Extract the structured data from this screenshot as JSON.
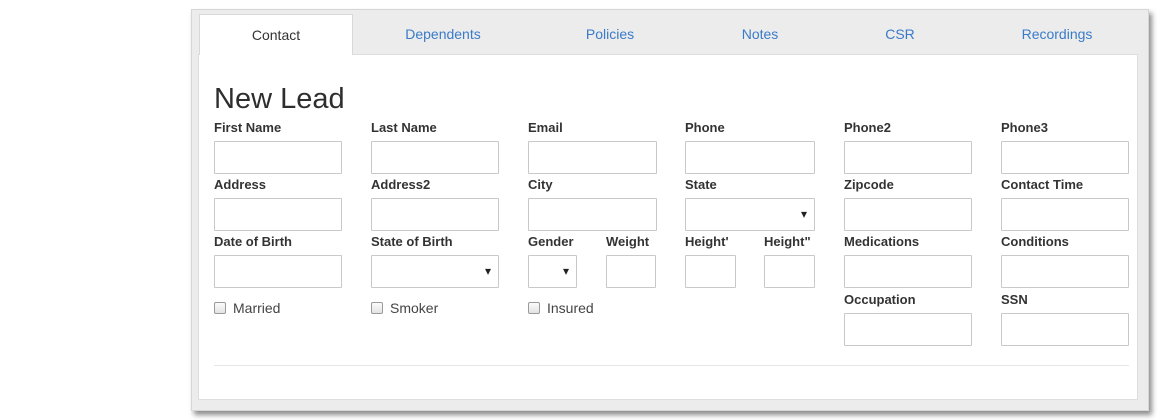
{
  "tabs": [
    {
      "label": "Contact",
      "active": true
    },
    {
      "label": "Dependents"
    },
    {
      "label": "Policies"
    },
    {
      "label": "Notes"
    },
    {
      "label": "CSR"
    },
    {
      "label": "Recordings"
    }
  ],
  "form": {
    "title": "New Lead",
    "labels": {
      "first_name": "First Name",
      "last_name": "Last Name",
      "email": "Email",
      "phone": "Phone",
      "phone2": "Phone2",
      "phone3": "Phone3",
      "address": "Address",
      "address2": "Address2",
      "city": "City",
      "state": "State",
      "zipcode": "Zipcode",
      "contact_time": "Contact Time",
      "date_of_birth": "Date of Birth",
      "state_of_birth": "State of Birth",
      "gender": "Gender",
      "weight": "Weight",
      "height_ft": "Height'",
      "height_in": "Height\"",
      "medications": "Medications",
      "conditions": "Conditions",
      "occupation": "Occupation",
      "ssn": "SSN"
    },
    "checkboxes": {
      "married": "Married",
      "smoker": "Smoker",
      "insured": "Insured"
    },
    "values": {
      "first_name": "",
      "last_name": "",
      "email": "",
      "phone": "",
      "phone2": "",
      "phone3": "",
      "address": "",
      "address2": "",
      "city": "",
      "state": "",
      "zipcode": "",
      "contact_time": "",
      "date_of_birth": "",
      "state_of_birth": "",
      "gender": "",
      "weight": "",
      "height_ft": "",
      "height_in": "",
      "medications": "",
      "conditions": "",
      "occupation": "",
      "ssn": ""
    }
  },
  "colors": {
    "tab_link": "#3a7bc8",
    "panel_bg": "#ececec"
  }
}
